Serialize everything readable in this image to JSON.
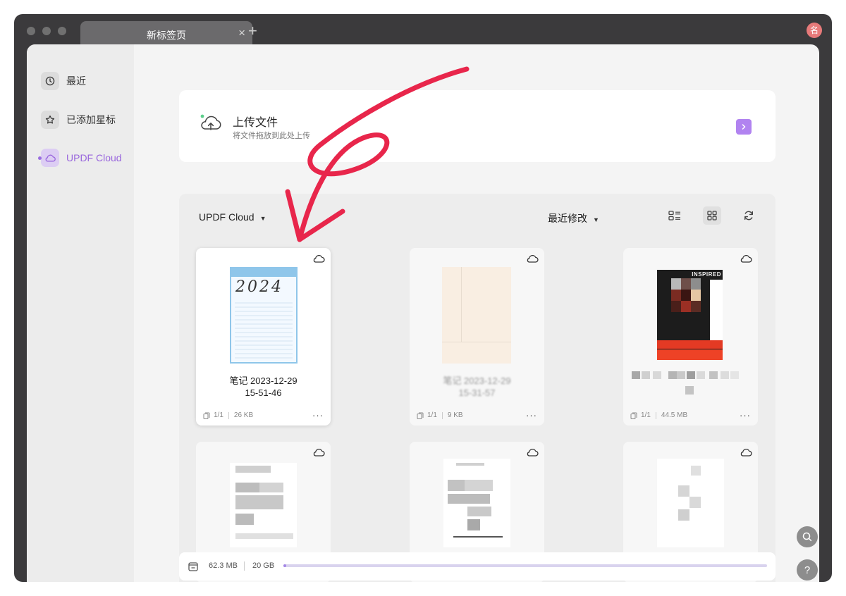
{
  "tab": {
    "title": "新标签页",
    "close": "×"
  },
  "titlebar": {
    "new_tab": "+",
    "avatar": "名"
  },
  "sidebar": {
    "items": [
      {
        "label": "最近",
        "icon": "clock-icon"
      },
      {
        "label": "已添加星标",
        "icon": "star-icon"
      },
      {
        "label": "UPDF Cloud",
        "icon": "cloud-icon",
        "active": true
      }
    ]
  },
  "upload": {
    "title": "上传文件",
    "subtitle": "将文件拖放到此处上传",
    "go_icon": "chevron-right-icon"
  },
  "toolbar": {
    "folder": "UPDF Cloud",
    "sort": "最近修改"
  },
  "files": [
    {
      "name_line1": "笔记 2023-12-29",
      "name_line2": "15-51-46",
      "pages": "1/1",
      "size": "26 KB",
      "more": "···"
    },
    {
      "name_line1": "笔记 2023-12-29",
      "name_line2": "15-31-57",
      "pages": "1/1",
      "size": "9 KB",
      "more": "···"
    },
    {
      "pages": "1/1",
      "size": "44.5 MB",
      "more": "···"
    }
  ],
  "thumbnail_text": {
    "year": "2024",
    "cover_title": "INSPIRED"
  },
  "storage": {
    "used": "62.3 MB",
    "total": "20 GB",
    "used_fraction": 0.003
  },
  "colors": {
    "accent": "#9966dd",
    "annotation": "#e8264b",
    "window": "#3b3a3c"
  }
}
